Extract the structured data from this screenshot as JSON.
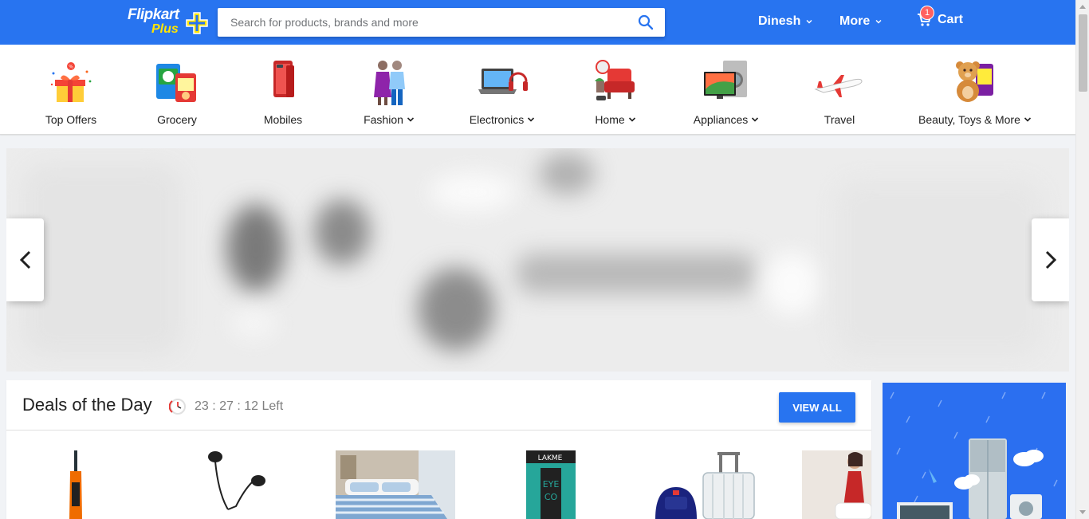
{
  "header": {
    "logo_text": "Flipkart",
    "logo_plus": "Plus",
    "search_placeholder": "Search for products, brands and more",
    "user_label": "Dinesh",
    "more_label": "More",
    "cart_label": "Cart",
    "cart_count": "1",
    "brand_color": "#2874f0",
    "accent_color": "#ffe500"
  },
  "categories": [
    {
      "label": "Top Offers",
      "icon": "gift-box-icon"
    },
    {
      "label": "Grocery",
      "icon": "grocery-icon"
    },
    {
      "label": "Mobiles",
      "icon": "mobile-phone-icon"
    },
    {
      "label": "Fashion",
      "icon": "fashion-models-icon"
    },
    {
      "label": "Electronics",
      "icon": "laptop-headphones-icon"
    },
    {
      "label": "Home",
      "icon": "armchair-icon"
    },
    {
      "label": "Appliances",
      "icon": "tv-washing-machine-icon"
    },
    {
      "label": "Travel",
      "icon": "airplane-icon"
    },
    {
      "label": "Beauty, Toys & More",
      "icon": "teddy-bear-icon"
    }
  ],
  "banner": {
    "prev_icon": "chevron-left-icon",
    "next_icon": "chevron-right-icon"
  },
  "deals": {
    "title": "Deals of the Day",
    "timer": "23 : 27 : 12 Left",
    "view_all_label": "VIEW ALL",
    "items": [
      {
        "icon": "cricket-bat-icon"
      },
      {
        "icon": "earphones-icon"
      },
      {
        "icon": "bedsheet-icon"
      },
      {
        "icon": "eyeliner-icon"
      },
      {
        "icon": "luggage-icon"
      },
      {
        "icon": "dress-icon"
      }
    ]
  },
  "ad": {
    "icon": "refrigerator-washing-machine-icon"
  }
}
